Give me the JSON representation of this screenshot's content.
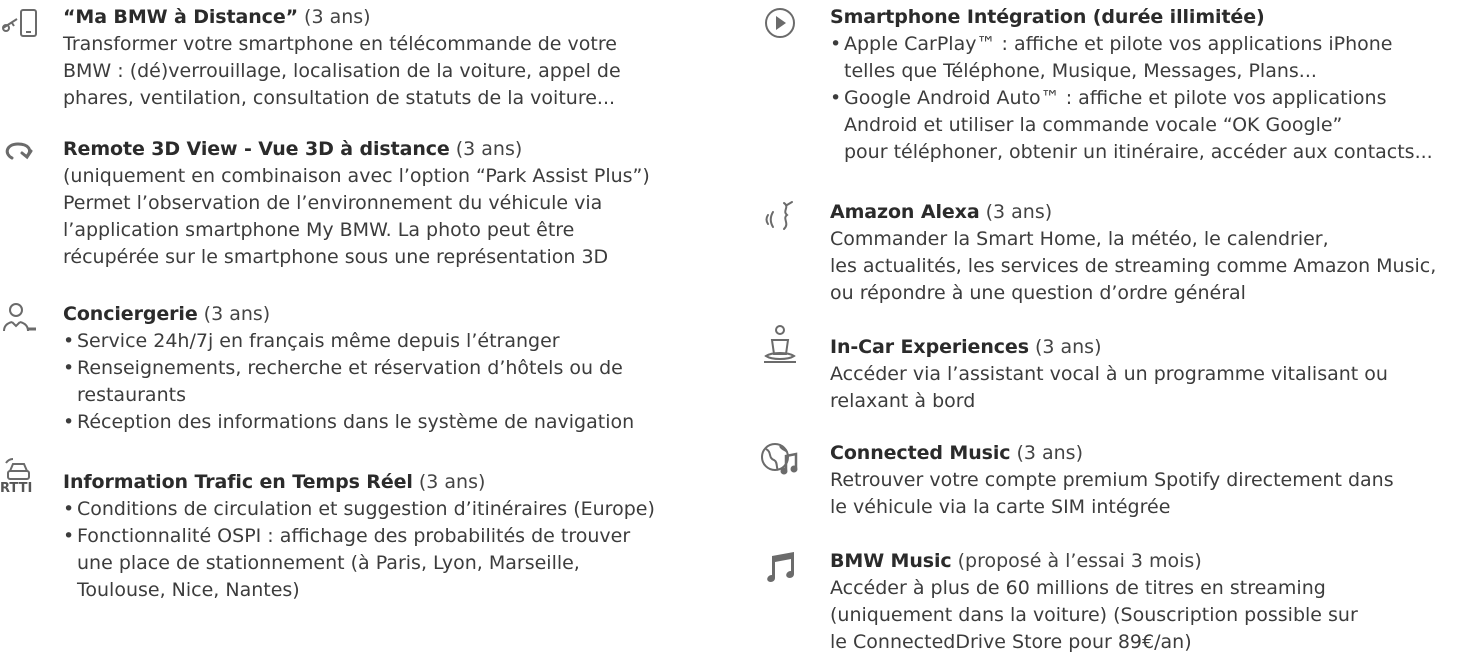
{
  "left": {
    "remote": {
      "title": "“Ma BMW à Distance”",
      "suffix": " (3 ans)",
      "lines": [
        "Transformer votre smartphone en télécommande de votre",
        "BMW : (dé)verrouillage, localisation de la voiture, appel de",
        "phares, ventilation, consultation de statuts de la voiture..."
      ]
    },
    "view3d": {
      "title": "Remote 3D View - Vue 3D à distance",
      "suffix": " (3 ans)",
      "lines": [
        "(uniquement en combinaison avec l’option “Park Assist Plus”)",
        "Permet l’observation de l’environnement du véhicule via",
        "l’application smartphone  My BMW. La photo peut être",
        "récupérée sur le smartphone sous une représentation 3D"
      ]
    },
    "concierge": {
      "title": "Conciergerie",
      "suffix": " (3 ans)",
      "b1": "Service 24h/7j en français même depuis l’étranger",
      "b2a": "Renseignements, recherche et réservation d’hôtels ou de",
      "b2b": "restaurants",
      "b3": "Réception des informations dans le système de navigation"
    },
    "traffic": {
      "icon_text": "RTTI",
      "title": "Information Trafic en Temps Réel",
      "suffix": " (3 ans)",
      "b1": "Conditions de circulation et suggestion d’itinéraires (Europe)",
      "b2a": "Fonctionnalité OSPI : affichage des probabilités de trouver",
      "b2b": "une place de stationnement (à Paris, Lyon, Marseille,",
      "b2c": "Toulouse, Nice, Nantes)"
    }
  },
  "right": {
    "smartphone": {
      "title": "Smartphone Intégration (durée illimitée)",
      "b1a": "Apple CarPlay™ : affiche et pilote vos applications iPhone",
      "b1b": "telles que Téléphone, Musique, Messages, Plans...",
      "b2a": "Google Android Auto™ : affiche et pilote vos applications",
      "b2b": "Android et utiliser la commande vocale “OK Google”",
      "b2c": "pour téléphoner, obtenir un itinéraire, accéder aux contacts..."
    },
    "alexa": {
      "title": "Amazon Alexa",
      "suffix": " (3 ans)",
      "lines": [
        "Commander la Smart Home, la météo, le calendrier,",
        "les actualités, les services de streaming comme Amazon Music,",
        "ou répondre à une question d’ordre général"
      ]
    },
    "incar": {
      "title": "In-Car Experiences",
      "suffix": " (3 ans)",
      "lines": [
        "Accéder via l’assistant vocal à un programme vitalisant ou",
        "relaxant à bord"
      ]
    },
    "connected": {
      "title": "Connected Music",
      "suffix": " (3 ans)",
      "lines": [
        "Retrouver votre compte premium Spotify directement dans",
        "le véhicule via la carte SIM intégrée"
      ]
    },
    "bmwmusic": {
      "title": "BMW Music",
      "suffix": " (proposé à l’essai 3 mois)",
      "lines": [
        "Accéder à plus de 60 millions de titres en streaming",
        "(uniquement dans la voiture) (Souscription possible sur",
        "le ConnectedDrive Store pour 89€/an)"
      ]
    }
  }
}
